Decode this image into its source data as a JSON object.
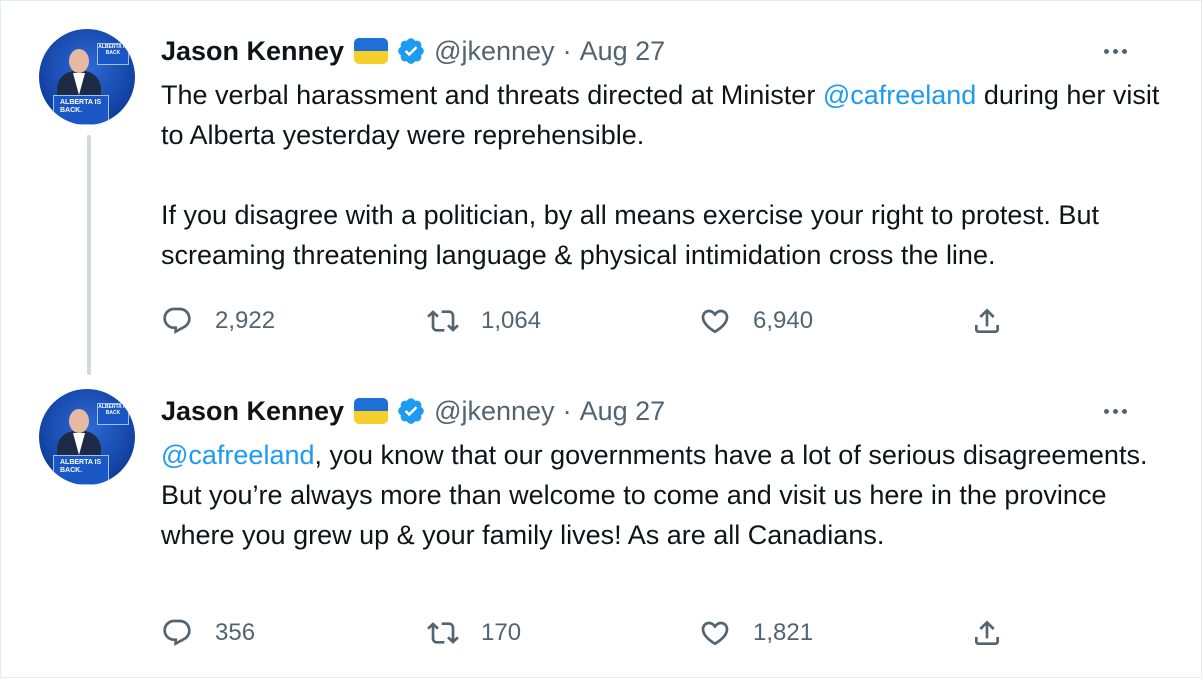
{
  "tweets": [
    {
      "author_name": "Jason Kenney",
      "handle": "@jkenney",
      "separator": "·",
      "date": "Aug 27",
      "avatar_sign_top": "ALBERTA IS BACK",
      "avatar_podium": "ALBERTA IS BACK.",
      "text_segments": [
        {
          "p1_a": "The verbal harassment and threats directed at Minister ",
          "p1_mention": "@cafreeland",
          "p1_b": " during her visit to Alberta yesterday were reprehensible."
        },
        {
          "p2": "If you disagree with a politician, by all means exercise your right to protest. But screaming threatening language & physical intimidation cross the line."
        }
      ],
      "replies": "2,922",
      "retweets": "1,064",
      "likes": "6,940"
    },
    {
      "author_name": "Jason Kenney",
      "handle": "@jkenney",
      "separator": "·",
      "date": "Aug 27",
      "avatar_sign_top": "ALBERTA IS BACK",
      "avatar_podium": "ALBERTA IS BACK.",
      "text_mention": "@cafreeland",
      "text_rest": ", you know that our governments have a lot of serious disagreements. But you’re always more than welcome to come and visit us here in the province where you grew up & your family lives! As are all Canadians.",
      "replies": "356",
      "retweets": "170",
      "likes": "1,821"
    }
  ],
  "icons": {
    "reply": "reply-icon",
    "retweet": "retweet-icon",
    "like": "heart-icon",
    "share": "share-icon",
    "more": "more-icon",
    "verified": "verified-badge-icon",
    "flag": "ukraine-flag-icon"
  },
  "colors": {
    "link": "#1d9bf0",
    "secondary_text": "#536471",
    "primary_text": "#0f1419",
    "verified": "#1d9bf0",
    "thread_line": "#cfd9de"
  }
}
